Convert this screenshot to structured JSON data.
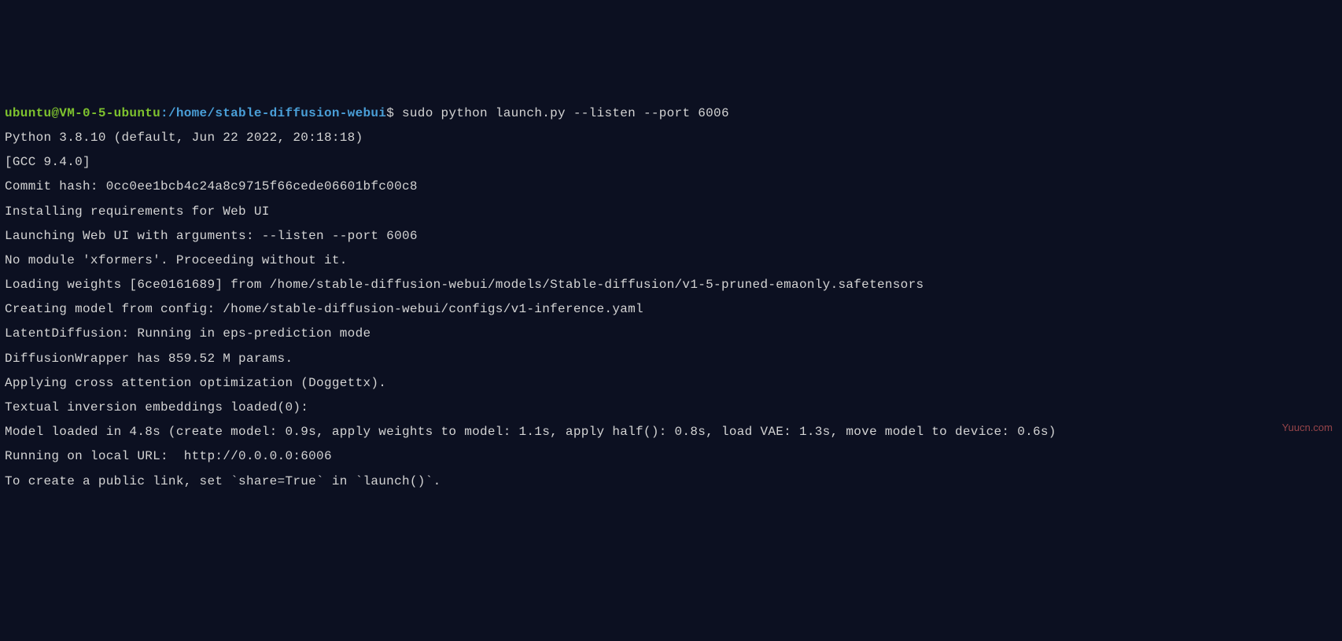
{
  "prompt": {
    "user": "ubuntu@VM-0-5-ubuntu",
    "separator": ":",
    "path": "/home/stable-diffusion-webui",
    "dollar": "$",
    "command": "sudo python launch.py --listen --port 6006"
  },
  "output": {
    "lines": [
      "Python 3.8.10 (default, Jun 22 2022, 20:18:18)",
      "[GCC 9.4.0]",
      "Commit hash: 0cc0ee1bcb4c24a8c9715f66cede06601bfc00c8",
      "Installing requirements for Web UI",
      "Launching Web UI with arguments: --listen --port 6006",
      "No module 'xformers'. Proceeding without it.",
      "Loading weights [6ce0161689] from /home/stable-diffusion-webui/models/Stable-diffusion/v1-5-pruned-emaonly.safetensors",
      "Creating model from config: /home/stable-diffusion-webui/configs/v1-inference.yaml",
      "LatentDiffusion: Running in eps-prediction mode",
      "DiffusionWrapper has 859.52 M params.",
      "Applying cross attention optimization (Doggettx).",
      "Textual inversion embeddings loaded(0):",
      "Model loaded in 4.8s (create model: 0.9s, apply weights to model: 1.1s, apply half(): 0.8s, load VAE: 1.3s, move model to device: 0.6s)",
      "Running on local URL:  http://0.0.0.0:6006",
      "",
      "To create a public link, set `share=True` in `launch()`."
    ]
  },
  "watermark": "Yuucn.com"
}
